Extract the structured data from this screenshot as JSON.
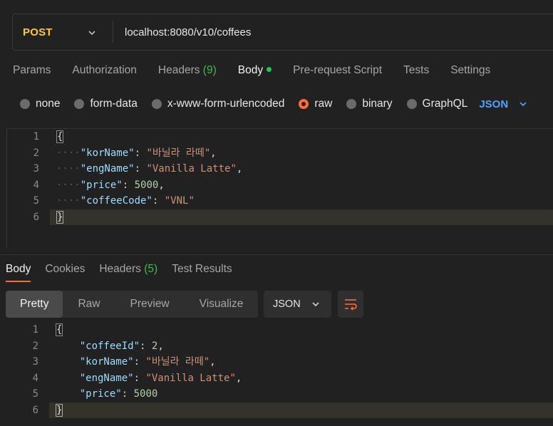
{
  "request": {
    "method": "POST",
    "url": "localhost:8080/v10/coffees"
  },
  "request_tabs": [
    {
      "label": "Params"
    },
    {
      "label": "Authorization"
    },
    {
      "label": "Headers",
      "count": "(9)"
    },
    {
      "label": "Body"
    },
    {
      "label": "Pre-request Script"
    },
    {
      "label": "Tests"
    },
    {
      "label": "Settings"
    }
  ],
  "body_types": [
    "none",
    "form-data",
    "x-www-form-urlencoded",
    "raw",
    "binary",
    "GraphQL"
  ],
  "body_type_selected": "raw",
  "body_format": "JSON",
  "request_body": {
    "line_numbers": [
      "1",
      "2",
      "3",
      "4",
      "5",
      "6"
    ],
    "open_brace": "{",
    "close_brace": "}",
    "fields": [
      {
        "key": "\"korName\"",
        "value": "\"바닐라 라떼\"",
        "sep": ": ",
        "end": ","
      },
      {
        "key": "\"engName\"",
        "value": "\"Vanilla Latte\"",
        "sep": ": ",
        "end": ","
      },
      {
        "key": "\"price\"",
        "value": "5000",
        "sep": ": ",
        "end": ","
      },
      {
        "key": "\"coffeeCode\"",
        "value": "\"VNL\"",
        "sep": ": ",
        "end": ""
      }
    ]
  },
  "response_tabs": [
    {
      "label": "Body"
    },
    {
      "label": "Cookies"
    },
    {
      "label": "Headers",
      "count": "(5)"
    },
    {
      "label": "Test Results"
    }
  ],
  "view_modes": [
    "Pretty",
    "Raw",
    "Preview",
    "Visualize"
  ],
  "response_format": "JSON",
  "response_body": {
    "line_numbers": [
      "1",
      "2",
      "3",
      "4",
      "5",
      "6"
    ],
    "open_brace": "{",
    "close_brace": "}",
    "fields": [
      {
        "key": "\"coffeeId\"",
        "value": "2",
        "sep": ": ",
        "end": ","
      },
      {
        "key": "\"korName\"",
        "value": "\"바닐라 라떼\"",
        "sep": ": ",
        "end": ","
      },
      {
        "key": "\"engName\"",
        "value": "\"Vanilla Latte\"",
        "sep": ": ",
        "end": ","
      },
      {
        "key": "\"price\"",
        "value": "5000",
        "sep": ": ",
        "end": ""
      }
    ]
  },
  "colors": {
    "method": "#ffc93c",
    "accent": "#ff6c37",
    "json_link": "#4ea3ff",
    "count_green": "#3fb950"
  }
}
